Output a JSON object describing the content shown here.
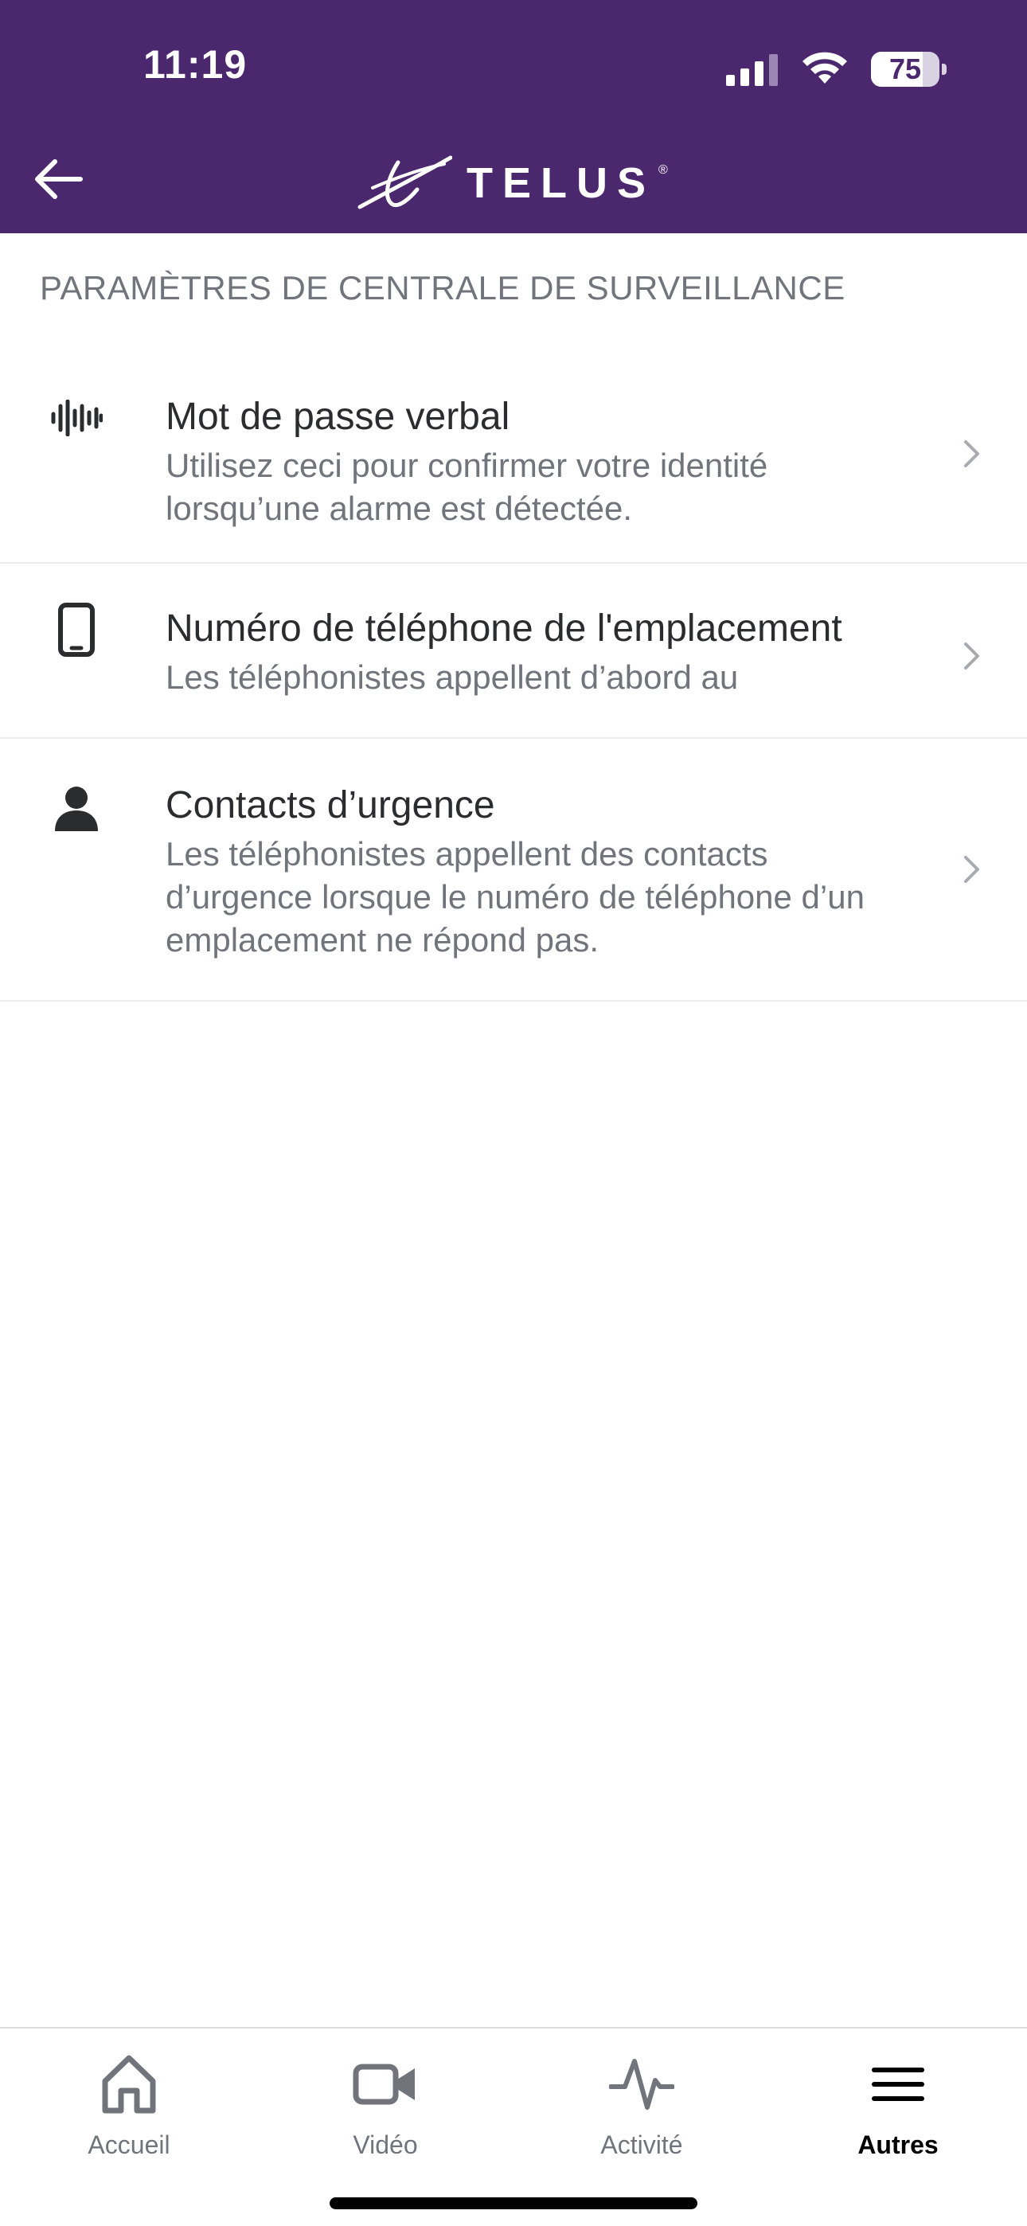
{
  "status_bar": {
    "time": "11:19",
    "battery_level": "75",
    "battery_fraction": 0.75
  },
  "header": {
    "brand": "TELUS",
    "brand_mark": "®",
    "back_icon": "arrow-left-icon",
    "background_color": "#4b286d"
  },
  "section": {
    "title": "PARAMÈTRES DE CENTRALE DE SURVEILLANCE"
  },
  "items": [
    {
      "icon": "voice-waveform-icon",
      "title": "Mot de passe verbal",
      "subtitle": "Utilisez ceci pour confirmer votre identité lorsqu’une alarme est détectée."
    },
    {
      "icon": "mobile-phone-icon",
      "title": "Numéro de téléphone de l'emplacement",
      "subtitle": "Les téléphonistes appellent d’abord au"
    },
    {
      "icon": "person-icon",
      "title": "Contacts d’urgence",
      "subtitle": "Les téléphonistes appellent des contacts d’urgence lorsque le numéro de téléphone d’un emplacement ne répond pas."
    }
  ],
  "tabbar": {
    "tabs": [
      {
        "label": "Accueil",
        "icon": "home-icon",
        "active": false
      },
      {
        "label": "Vidéo",
        "icon": "video-camera-icon",
        "active": false
      },
      {
        "label": "Activité",
        "icon": "activity-pulse-icon",
        "active": false
      },
      {
        "label": "Autres",
        "icon": "menu-icon",
        "active": true
      }
    ]
  },
  "colors": {
    "brand_purple": "#4b286d",
    "text_primary": "#2a2c2e",
    "text_secondary": "#71757b"
  }
}
